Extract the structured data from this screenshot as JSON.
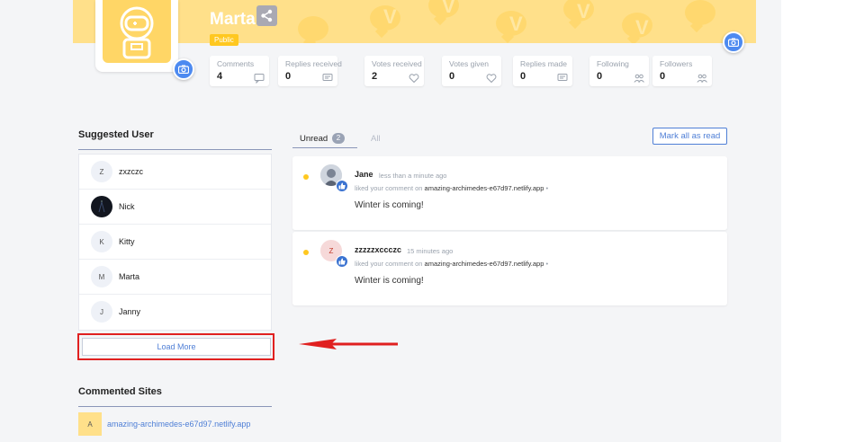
{
  "profile": {
    "username": "Marta",
    "badge": "Public"
  },
  "stats": [
    {
      "label": "Comments",
      "value": "4",
      "icon": "comment-icon"
    },
    {
      "label": "Replies received",
      "value": "0",
      "icon": "reply-icon"
    },
    {
      "label": "Votes received",
      "value": "2",
      "icon": "heart-icon"
    },
    {
      "label": "Votes given",
      "value": "0",
      "icon": "heart-icon"
    },
    {
      "label": "Replies made",
      "value": "0",
      "icon": "reply-icon"
    },
    {
      "label": "Following",
      "value": "0",
      "icon": "users-icon"
    },
    {
      "label": "Followers",
      "value": "0",
      "icon": "users-icon"
    }
  ],
  "suggested": {
    "title": "Suggested User",
    "users": [
      {
        "initial": "Z",
        "name": "zxzczc"
      },
      {
        "initial": "",
        "name": "Nick"
      },
      {
        "initial": "K",
        "name": "Kitty"
      },
      {
        "initial": "M",
        "name": "Marta"
      },
      {
        "initial": "J",
        "name": "Janny"
      }
    ],
    "load_more": "Load More"
  },
  "commented_sites": {
    "title": "Commented Sites",
    "sites": [
      {
        "initial": "A",
        "url": "amazing-archimedes-e67d97.netlify.app"
      }
    ]
  },
  "notifications": {
    "tab_unread": "Unread",
    "unread_count": "2",
    "tab_all": "All",
    "mark_all": "Mark all as read",
    "items": [
      {
        "user": "Jane",
        "avatar_initial": "",
        "time": "less than a minute ago",
        "action": "liked your comment on",
        "site": "amazing-archimedes-e67d97.netlify.app",
        "comment": "Winter is coming!"
      },
      {
        "user": "zzzzzxccczc",
        "avatar_initial": "Z",
        "time": "15 minutes ago",
        "action": "liked your comment on",
        "site": "amazing-archimedes-e67d97.netlify.app",
        "comment": "Winter is coming!"
      }
    ]
  },
  "colors": {
    "banner": "#ffe08a",
    "accent": "#4f7fd6",
    "badge": "#ffc820",
    "highlight": "#e02020"
  }
}
